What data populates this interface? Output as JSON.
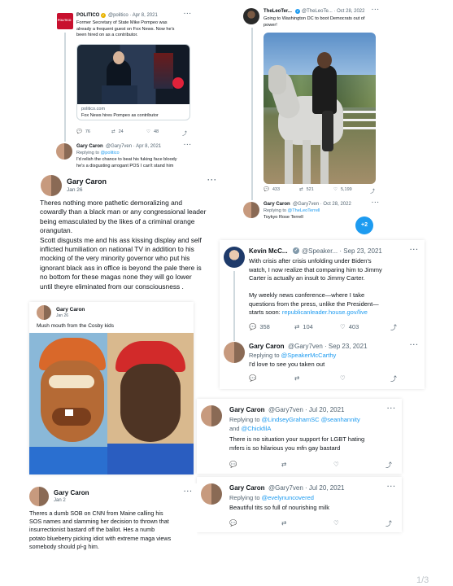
{
  "politico": {
    "logo_text": "POLITICO",
    "name": "POLITICO",
    "handle": "@politico · Apr 8, 2021",
    "text": "Former Secretary of State Mike Pompeo was\nalready a frequent guest on Fox News. Now he's\nbeen hired on as a contributor.",
    "link_domain": "politico.com",
    "link_title": "Fox News hires Pompeo as contributor",
    "replies": "76",
    "retweets": "24",
    "likes": "48"
  },
  "gary_pompeo_reply": {
    "name": "Gary Caron",
    "handle": "@Gary7ven · Apr 8, 2021",
    "replying_prefix": "Replying to ",
    "replying_to": "@politico",
    "text": "I'd relish the chance to beat his fuking face bloody\nhe's a disgusting arrogant POS I can't stand him"
  },
  "leo_tweet": {
    "name": "TheLeoTer...",
    "handle": "@TheLeoTe... · Oct 28, 2022",
    "text": "Going to Washington DC to boot Democrats out of\npower!",
    "replies": "433",
    "retweets": "521",
    "likes": "5,199"
  },
  "gary_leo_reply": {
    "name": "Gary Caron",
    "handle": "@Gary7ven · Oct 28, 2022",
    "replying_prefix": "Replying to ",
    "replying_to": "@TheLeoTerrell",
    "text": "Toykyo Rose Terrell",
    "fab_icon": "+2"
  },
  "gary_big_post": {
    "name": "Gary Caron",
    "date": "Jan 26",
    "text": "Theres nothing more pathetic demoralizing and\ncowardly than a black man or any congressional leader\nbeing emasculated by the likes of a criminal orange\norangutan.\nScott disgusts me and his ass kissing display and self\ninflicted humiliation on national TV in addition to his\nmocking of the very minority governor who put his\nignorant black ass in office is beyond the pale there is\nno bottom for these magas none they will go lower\nuntil theyre eliminated from our consciousness ."
  },
  "kevin_tweet": {
    "name": "Kevin McC...",
    "handle": "@Speaker... · Sep 23, 2021",
    "text": "With crisis after crisis unfolding under Biden's\nwatch, I now realize that comparing him to Jimmy\nCarter is actually an insult to Jimmy Carter.\n\nMy weekly news conference—where I take\nquestions from the press, unlike the President—\nstarts soon: ",
    "link": "republicanleader.house.gov/live",
    "replies": "358",
    "retweets": "104",
    "likes": "403"
  },
  "gary_kevin_reply": {
    "name": "Gary Caron",
    "handle": "@Gary7ven · Sep 23, 2021",
    "replying_prefix": "Replying to ",
    "replying_to": "@SpeakerMcCarthy",
    "text": "I'd love to see you taken out"
  },
  "gary_cosby_post": {
    "name": "Gary Caron",
    "date": "Jan 26",
    "text": "Mush mouth from the Cosby kids"
  },
  "gary_lgbt_reply": {
    "name": "Gary Caron",
    "handle": "@Gary7ven · Jul 20, 2021",
    "replying_prefix": "Replying to ",
    "replying_to_1": "@LindseyGrahamSC",
    "replying_to_2": "@seanhannity",
    "replying_and": "and ",
    "replying_to_3": "@ChickfilA",
    "text": "There is no situation your support for LGBT hating\nmfers is so hilarious you mfn gay bastard"
  },
  "gary_evelyn_reply": {
    "name": "Gary Caron",
    "handle": "@Gary7ven · Jul 20, 2021",
    "replying_prefix": "Replying to ",
    "replying_to": "@evelynuncovered",
    "text": "Beautiful tits so full of nourishing milk"
  },
  "gary_cnn_post": {
    "name": "Gary Caron",
    "date": "Jan 2",
    "text": "Theres a dumb SOB on CNN from Maine calling his\nSOS names and slamming her decision to thrown that\ninsurrectionist bastard off the ballot. Hes a numb\npotato blueberry picking idiot with extreme maga views\nsomebody should pl-g him."
  },
  "page_number": "1/3",
  "colors": {
    "accent": "#1d9bf0",
    "muted": "#536471",
    "politico_red": "#c8102e"
  },
  "icons": [
    "reply-icon",
    "retweet-icon",
    "like-icon",
    "share-icon",
    "more-icon",
    "verified-icon"
  ]
}
